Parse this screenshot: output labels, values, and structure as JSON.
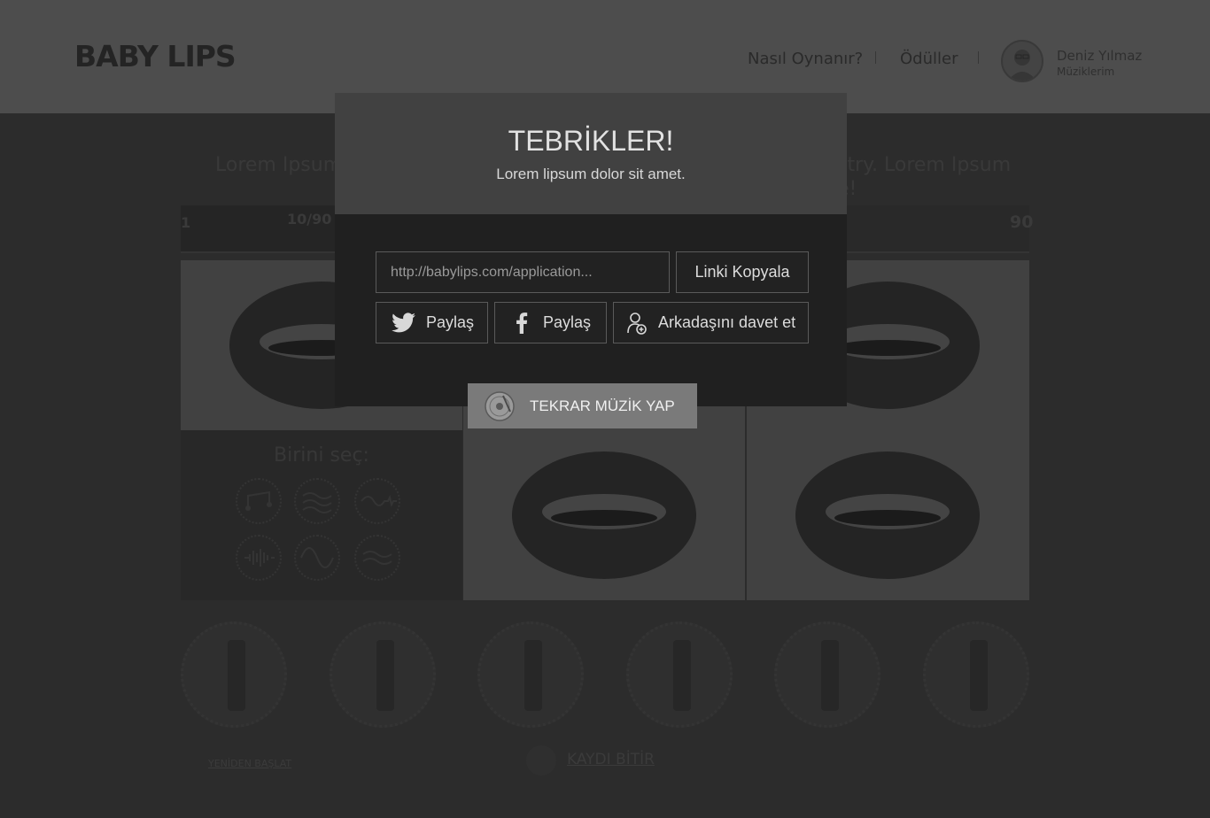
{
  "header": {
    "logo": "BABY LIPS",
    "nav": [
      "Nasıl Oynanır?",
      "Ödüller"
    ],
    "user_name": "Deniz Yılmaz",
    "user_sub": "Müziklerim"
  },
  "background": {
    "text_left": "Lorem Ipsum",
    "text_right": "stry. Lorem Ipsum",
    "text_right_line2": "e!",
    "progress_label": "10/90",
    "progress_start": "1",
    "progress_end": "90",
    "select_label": "Birini seç:",
    "restart": "YENİDEN BAŞLAT",
    "stop": "KAYDI BİTİR"
  },
  "modal": {
    "title": "TEBRİKLER!",
    "subtitle": "Lorem lipsum dolor sit amet.",
    "link_placeholder": "http://babylips.com/application...",
    "copy_button": "Linki Kopyala",
    "twitter_share": "Paylaş",
    "facebook_share": "Paylaş",
    "invite_button": "Arkadaşını davet et",
    "repeat_button": "TEKRAR MÜZİK YAP"
  },
  "icons": {
    "twitter": "twitter-icon",
    "facebook": "facebook-icon",
    "invite": "add-user-icon",
    "repeat": "vinyl-record-icon",
    "stop": "record-stop-icon"
  }
}
